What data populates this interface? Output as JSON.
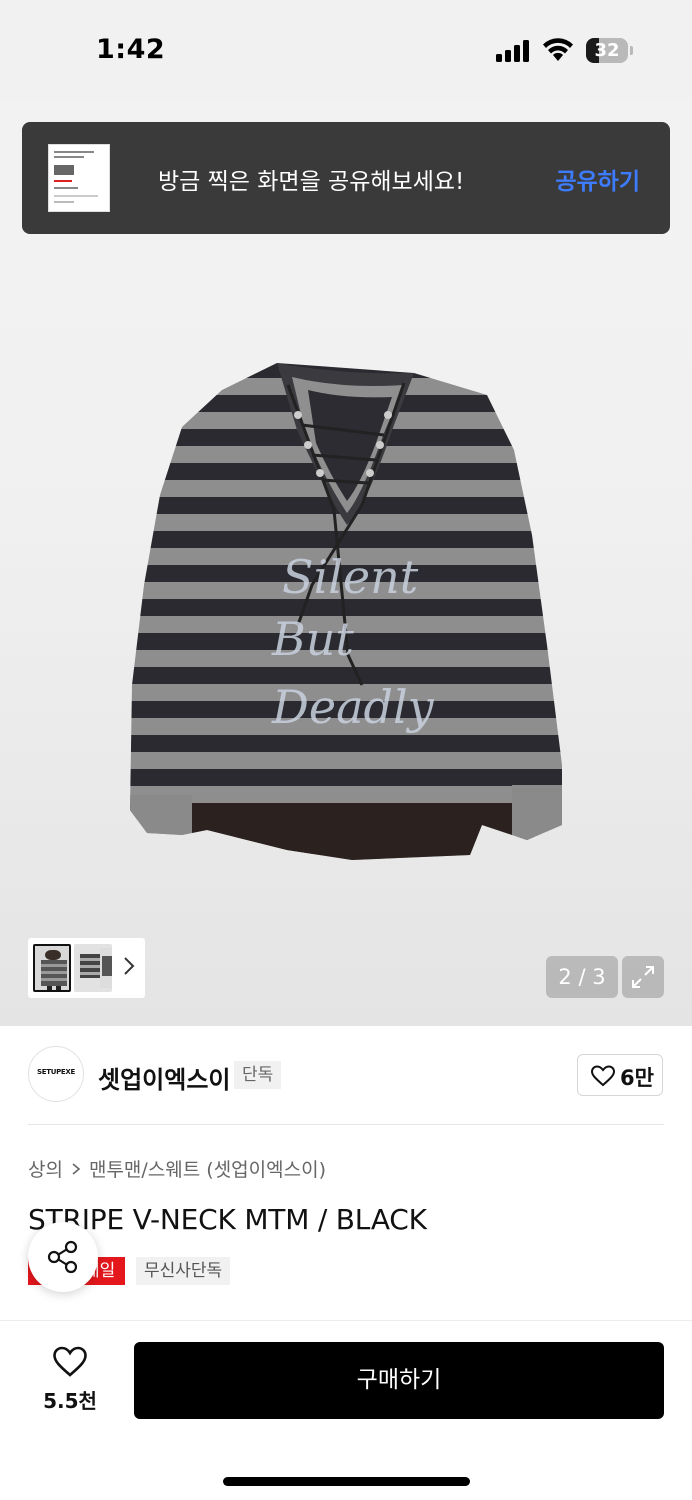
{
  "status_bar": {
    "time": "1:42",
    "battery": "32",
    "battery_level": 0.32
  },
  "share_toast": {
    "message": "방금 찍은 화면을 공유해보세요!",
    "action": "공유하기"
  },
  "gallery": {
    "counter": "2 / 3"
  },
  "brand": {
    "logo_text": "SETUPEXE",
    "name": "셋업이엑스이",
    "badge": "단독",
    "likes": "6만"
  },
  "breadcrumb": {
    "category": "상의",
    "subcategory": "맨투맨/스웨트 (셋업이엑스이)"
  },
  "product": {
    "title": "STRIPE V-NECK MTM / BLACK",
    "tags": [
      "세일",
      "무신사단독"
    ]
  },
  "bottom_bar": {
    "wish_count": "5.5천",
    "buy_label": "구매하기"
  },
  "colors": {
    "accent": "#3d7bff",
    "sale": "#e3171c",
    "buy_button": "#000000"
  }
}
